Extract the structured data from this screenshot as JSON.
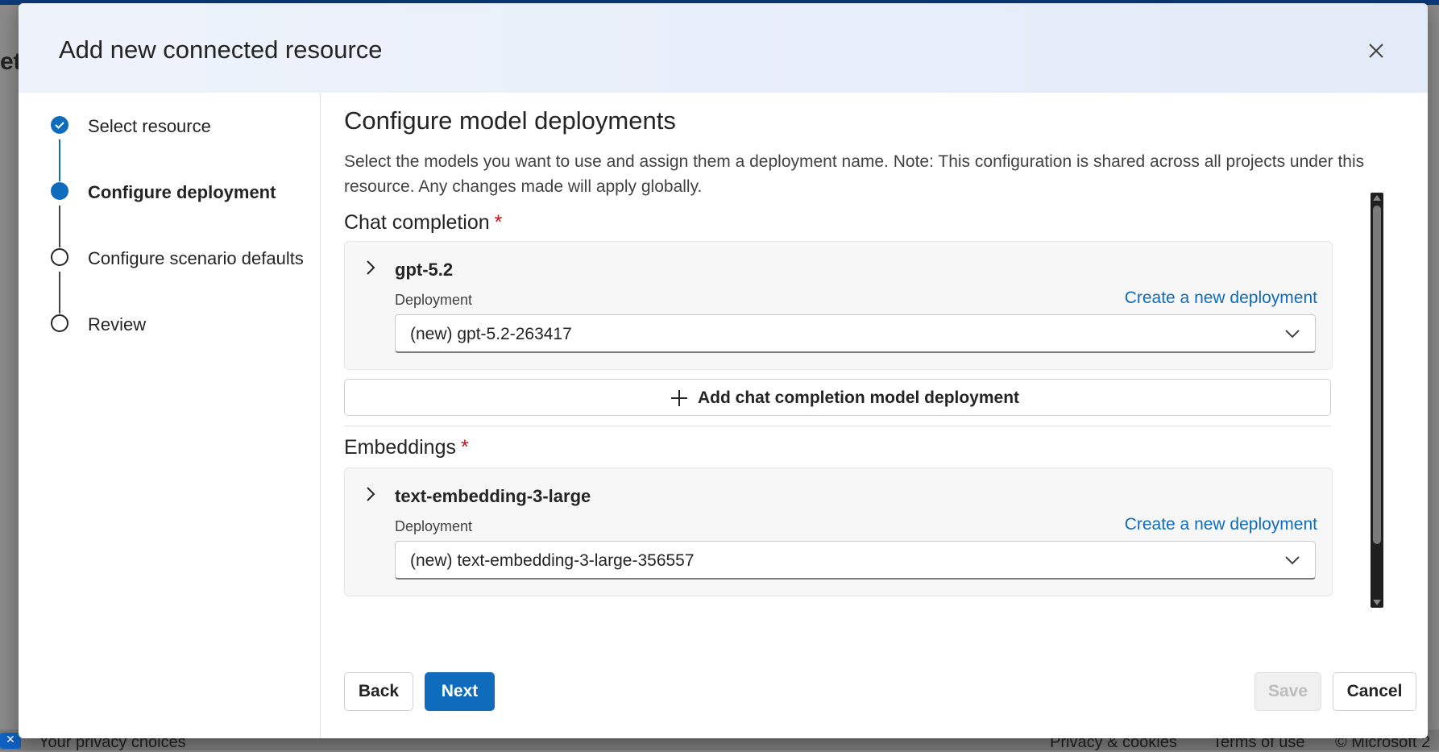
{
  "background": {
    "footer_links": [
      "Your privacy choices",
      "Privacy & cookies",
      "Terms of use",
      "© Microsoft 2"
    ],
    "left_fragment": "et"
  },
  "dialog": {
    "title": "Add new connected resource",
    "close_icon": "close-icon"
  },
  "stepper": {
    "steps": [
      {
        "label": "Select resource",
        "state": "done"
      },
      {
        "label": "Configure deployment",
        "state": "current"
      },
      {
        "label": "Configure scenario defaults",
        "state": "todo"
      },
      {
        "label": "Review",
        "state": "todo"
      }
    ]
  },
  "content": {
    "title": "Configure model deployments",
    "description": "Select the models you want to use and assign them a deployment name. Note: This configuration is shared across all projects under this resource. Any changes made will apply globally.",
    "chat": {
      "heading": "Chat completion",
      "required_mark": "*",
      "model_name": "gpt-5.2",
      "field_label": "Deployment",
      "create_link": "Create a new deployment",
      "selected_value": "(new) gpt-5.2-263417",
      "add_button": "Add chat completion model deployment"
    },
    "embeddings": {
      "heading": "Embeddings",
      "required_mark": "*",
      "model_name": "text-embedding-3-large",
      "field_label": "Deployment",
      "create_link": "Create a new deployment",
      "selected_value": "(new) text-embedding-3-large-356557"
    }
  },
  "footer": {
    "back": "Back",
    "next": "Next",
    "save": "Save",
    "cancel": "Cancel"
  },
  "colors": {
    "accent": "#0f6cbd",
    "required": "#c50f1f",
    "link": "#0f6cbd"
  }
}
